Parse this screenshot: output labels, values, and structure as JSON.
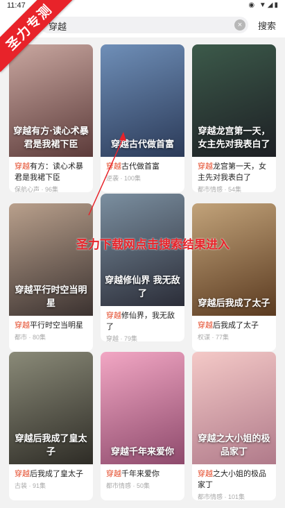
{
  "status": {
    "time": "11:47",
    "icons": "◉ ▼◢▮"
  },
  "search": {
    "query": "穿越",
    "clear": "×",
    "button_label": "搜索"
  },
  "watermark": {
    "ribbon": "圣力专测",
    "overlay": "圣力下载网点击搜索结果进入"
  },
  "cards": [
    {
      "poster_title": "穿越有方·读心术暴君是我裙下臣",
      "kw": "穿越",
      "rest": "有方：读心术暴君是我裙下臣",
      "meta": "保航心声 · 96集",
      "colors": [
        "#c9a7a0",
        "#5c3b3a"
      ]
    },
    {
      "poster_title": "穿越古代做首富",
      "kw": "穿越",
      "rest": "古代做首富",
      "meta": "逆袭 · 100集",
      "colors": [
        "#6f8fb8",
        "#2b3a58"
      ]
    },
    {
      "poster_title": "穿越龙宫第一天，女主先对我表白了",
      "kw": "穿越",
      "rest": "龙宫第一天，女主先对我表白了",
      "meta": "都市情感 · 54集",
      "colors": [
        "#3c5a4a",
        "#1d1f24"
      ]
    },
    {
      "poster_title": "穿越平行时空当明星",
      "kw": "穿越",
      "rest": "平行时空当明星",
      "meta": "都市 · 80集",
      "colors": [
        "#b9a08c",
        "#3b3230"
      ]
    },
    {
      "poster_title": "穿越修仙界 我无敌了",
      "kw": "穿越",
      "rest": "修仙界，我无敌了",
      "meta": "穿越 · 79集",
      "colors": [
        "#7b8fa0",
        "#2b2d38"
      ]
    },
    {
      "poster_title": "穿越后我成了太子",
      "kw": "穿越",
      "rest": "后我成了太子",
      "meta": "权谋 · 77集",
      "colors": [
        "#c2a37a",
        "#5a3a20"
      ]
    },
    {
      "poster_title": "穿越后我成了皇太子",
      "kw": "穿越",
      "rest": "后我成了皇太子",
      "meta": "古装 · 91集",
      "colors": [
        "#8a8a78",
        "#2e2c26"
      ]
    },
    {
      "poster_title": "穿越千年来爱你",
      "kw": "穿越",
      "rest": "千年来爱你",
      "meta": "都市情感 · 50集",
      "colors": [
        "#f2a7c4",
        "#8e4a6c"
      ]
    },
    {
      "poster_title": "穿越之大小姐的极品家丁",
      "kw": "穿越",
      "rest": "之大小姐的极品家丁",
      "meta": "都市情感 · 101集",
      "colors": [
        "#f4c9c7",
        "#b07a8a"
      ]
    }
  ]
}
